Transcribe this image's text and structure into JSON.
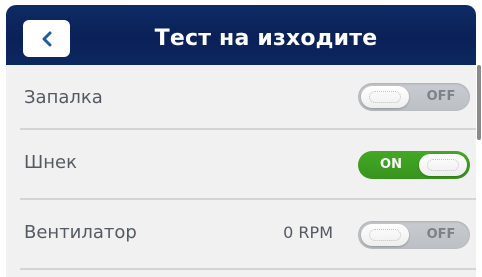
{
  "header": {
    "title": "Тест на изходите",
    "back_icon": "chevron-left-icon"
  },
  "rows": [
    {
      "label": "Запалка",
      "value": "",
      "toggle": "OFF",
      "on": false
    },
    {
      "label": "Шнек",
      "value": "",
      "toggle": "ON",
      "on": true
    },
    {
      "label": "Вентилатор",
      "value": "0 RPM",
      "toggle": "OFF",
      "on": false
    }
  ],
  "colors": {
    "header_bg": "#0a2157",
    "list_bg": "#f1f1f2",
    "toggle_on": "#3b9a1f",
    "toggle_off": "#c2c5ca",
    "label_text": "#555a62"
  }
}
